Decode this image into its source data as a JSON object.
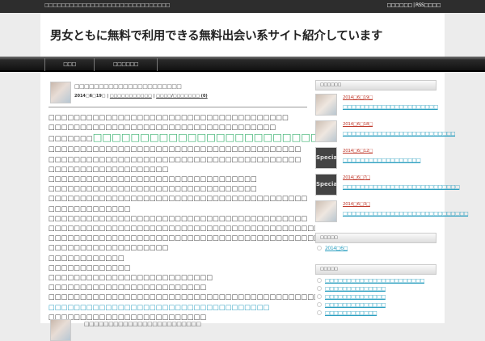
{
  "topbar": {
    "description": "□□□□□□□□□□□□□□□□□□□□□□□□□□□□□□",
    "link1": "□□□□□□",
    "link2": "RSS□□□□",
    "separator": "|"
  },
  "header": {
    "title": "男女ともに無料で利用できる無料出会い系サイト紹介しています"
  },
  "nav": [
    "□□□",
    "□□□□□□"
  ],
  "post": {
    "title": "□□□□□□□□□□□□□□□□□□□□□□",
    "date": "2014□6□19□",
    "category": "□□□□□□□□□□□",
    "comments": "□□□□/□□□□□□□ (0)",
    "lines": [
      {
        "text": "□□□□□□□□□□□□□□□□□□□□□□□□□□□□□□□□□□□□□□"
      },
      {
        "text": "□□□□□□□□□□□□□□□□□□□□□□□□□□□□□□□□□□□□"
      },
      {
        "text": "□□□□□□□",
        "link": "□□□□□□□□□□□□□□□□□□□□□□□□"
      },
      {
        "text": "□□□□□□□□□□□□□□□□□□□□□□□□□□□□□□□□□□□□□□□□"
      },
      {
        "text": "□□□□□□□□□□□□□□□□□□□□□□□□□□□□□□□□□□□□□□□□"
      },
      {
        "text": "□□□□□□□□□□□□□□□□□□□"
      },
      {
        "text": "□□□□□□□□□□□□□□□□□□□□□□□□□□□□□□□□□"
      },
      {
        "text": "□□□□□□□□□□□□□□□□□□□□□□□□□□□□□□□□□"
      },
      {
        "text": "□□□□□□□□□□□□□□□□□□□□□□□□□□□□□□□□□□□□□□□□□"
      },
      {
        "text": "□□□□□□□□□□□□□"
      },
      {
        "text": "□□□□□□□□□□□□□□□□□□□□□□□□□□□□□□□□□□□□□□□□□"
      },
      {
        "text": "□□□□□□□□□□□□□□□□□□□□□□□□□□□□□□□□□□□□□□□□□□□"
      },
      {
        "text": "□□□□□□□□□□□□□□□□□□□□□□□□□□□□□□□□□□□□□□□□□□□□□□"
      },
      {
        "text": "□□□□□□□□□□□□□□□□□□□"
      },
      {
        "text": "□□□□□□□□□□□□"
      },
      {
        "text": "□□□□□□□□□□□□□"
      },
      {
        "text": "□□□□□□□□□□□□□□□□□□□□□□□□□□"
      },
      {
        "text": "□□□□□□□□□□□□□□□□□□□□□□□□□"
      },
      {
        "text": "□□□□□□□□□□□□□□□□□□□□□□□□□□□□□□□□□□□□□□□□□□□□□□□□□"
      },
      {
        "text": "□□□□□□□□□□□□□□□□□□□□□□□□□□□□□□□□□□□",
        "blue": true
      },
      {
        "text": "□□□□□□□□□□□□□□□□□□□□□□□□□"
      }
    ]
  },
  "post2": {
    "title": "□□□□□□□□□□□□□□□□□□□□□□□□"
  },
  "sidebar": {
    "recent_title": "□□□□□□",
    "recent": [
      {
        "date": "2014□6□19□",
        "title": "□□□□□□□□□□□□□□□□□□□□□□",
        "thumb": "photo"
      },
      {
        "date": "2014□6□18□",
        "title": "□□□□□□□□□□□□□□□□□□□□□□□□□□",
        "thumb": "photo"
      },
      {
        "date": "2014□6□12□",
        "title": "□□□□□□□□□□□□□□□□□□",
        "thumb": "Special"
      },
      {
        "date": "2014□6□7□",
        "title": "□□□□□□□□□□□□□□□□□□□□□□□□□□□",
        "thumb": "Special"
      },
      {
        "date": "2014□6□3□",
        "title": "□□□□□□□□□□□□□□□□□□□□□□□□□□□□□",
        "thumb": "photo"
      }
    ],
    "archive_title": "□□□□□",
    "archives": [
      "2014□6□"
    ],
    "category_title": "□□□□□",
    "categories": [
      "□□□□□□□□□□□□□□□□□□□□□□□",
      "□□□□□□□□□□□□□□",
      "□□□□□□□□□□□□□□",
      "□□□□□□□□□□□□□□",
      "□□□□□□□□□□□□"
    ]
  }
}
